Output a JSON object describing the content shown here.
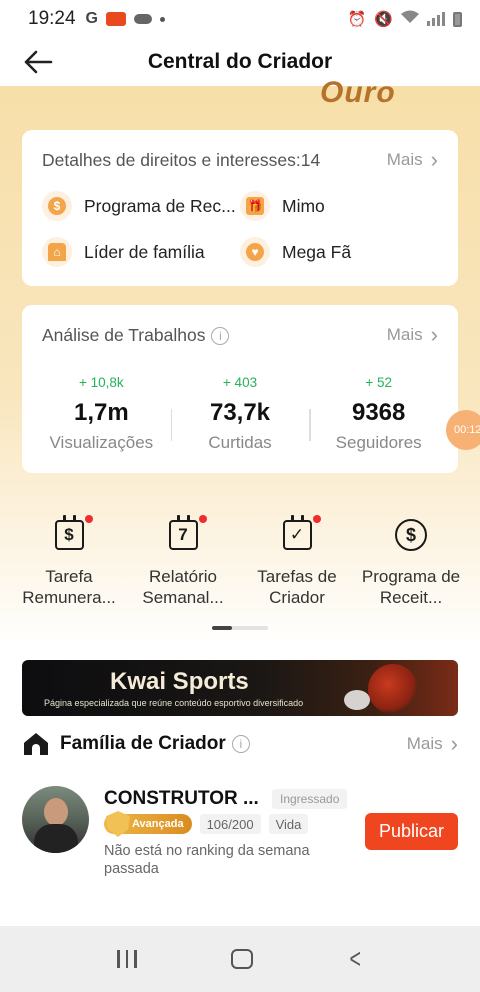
{
  "status_bar": {
    "time": "19:24",
    "left_icon_g": "G",
    "icons": [
      "google-icon",
      "record-icon",
      "cloud-icon",
      "dot-icon",
      "alarm-icon",
      "mute-icon",
      "wifi-icon",
      "signal-icon",
      "battery-icon"
    ]
  },
  "header": {
    "title": "Central do Criador",
    "back_icon": "arrow-left-icon"
  },
  "hero": {
    "level_text": "Ouro"
  },
  "rights": {
    "title": "Detalhes de direitos e interesses:14",
    "more": "Mais",
    "items": [
      {
        "label": "Programa de Rec...",
        "icon": "dollar-coin-icon"
      },
      {
        "label": "Mimo",
        "icon": "gift-icon"
      },
      {
        "label": "Líder de família",
        "icon": "family-house-icon"
      },
      {
        "label": "Mega Fã",
        "icon": "fan-user-icon"
      }
    ]
  },
  "analysis": {
    "title": "Análise de Trabalhos",
    "more": "Mais",
    "stats": [
      {
        "delta": "+ 10,8k",
        "value": "1,7m",
        "label": "Visualizações"
      },
      {
        "delta": "+ 403",
        "value": "73,7k",
        "label": "Curtidas"
      },
      {
        "delta": "+ 52",
        "value": "9368",
        "label": "Seguidores"
      }
    ]
  },
  "floating_timer": "00:12",
  "tasks": [
    {
      "label": "Tarefa Remunera...",
      "icon_text": "$",
      "icon": "calendar-dollar-icon",
      "has_dot": true
    },
    {
      "label": "Relatório Semanal...",
      "icon_text": "7",
      "icon": "calendar-seven-icon",
      "has_dot": true
    },
    {
      "label": "Tarefas de Criador",
      "icon_text": "✓",
      "icon": "calendar-check-icon",
      "has_dot": true
    },
    {
      "label": "Programa de Receit...",
      "icon_text": "$",
      "icon": "dollar-circle-icon",
      "has_dot": false
    }
  ],
  "banner": {
    "title": "Kwai Sports",
    "subtitle": "Página especializada que reúne conteúdo esportivo diversificado"
  },
  "family": {
    "title": "Família de Criador",
    "more": "Mais",
    "member": {
      "name": "CONSTRUTOR ...",
      "joined_badge": "Ingressado",
      "level_badge": "Avançada",
      "progress": "106/200",
      "tag": "Vida",
      "note": "Não está no ranking da semana passada",
      "publish_label": "Publicar"
    }
  },
  "colors": {
    "accent": "#f0461f",
    "positive": "#25b25b",
    "hero_gold": "#f7dfa9",
    "level_text": "#b5722a"
  }
}
